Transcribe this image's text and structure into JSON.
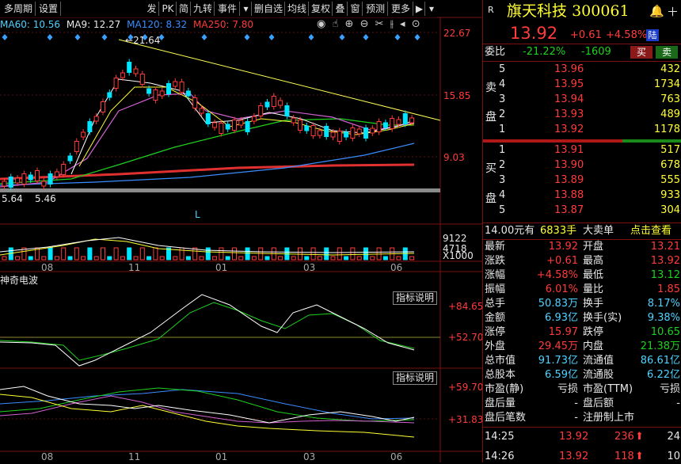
{
  "toolbar": {
    "items": [
      "多周期",
      "设置",
      "发",
      "PK",
      "简",
      "九转",
      "事件",
      "",
      "删自选",
      "均线",
      "复权",
      "叠",
      "窗",
      "预测",
      "更多",
      "",
      ""
    ],
    "icons": [
      "dropdown-icon",
      "arrow-icon",
      "menu-icon"
    ]
  },
  "ma_legend": {
    "ma60": "MA60: 10.56",
    "ma9": "MA9: 12.27",
    "ma120": "MA120: 8.32",
    "ma250": "MA250: 7.80"
  },
  "price_chart": {
    "peak_label": "21.64",
    "low_label_a": "5.64",
    "low_label_b": "5.46",
    "marker_l": "L",
    "axis": [
      "22.67",
      "15.85",
      "9.03"
    ]
  },
  "volume_chart": {
    "axis": [
      "9122",
      "4718",
      "X1000"
    ]
  },
  "date_axis": [
    "08",
    "11",
    "01",
    "03",
    "06"
  ],
  "indicator1": {
    "title": "神奇电波",
    "button": "指标说明",
    "axis": [
      "+84.65",
      "+52.70"
    ]
  },
  "indicator2": {
    "button": "指标说明",
    "axis": [
      "+59.70",
      "+31.83"
    ]
  },
  "quote": {
    "market_badge": "R",
    "name": "旗天科技",
    "code": "300061",
    "price": "13.92",
    "change": "+0.61",
    "change_pct": "+4.58%",
    "exchange_badge": "陆",
    "weibi_label": "委比",
    "weibi": "-21.22%",
    "weicha": "-1609",
    "buy_btn": "买",
    "sell_btn": "卖",
    "sell_label": [
      "卖",
      "盘"
    ],
    "buy_label": [
      "买",
      "盘"
    ],
    "asks": [
      {
        "lvl": "5",
        "price": "13.96",
        "vol": "432"
      },
      {
        "lvl": "4",
        "price": "13.95",
        "vol": "1734"
      },
      {
        "lvl": "3",
        "price": "13.94",
        "vol": "763"
      },
      {
        "lvl": "2",
        "price": "13.93",
        "vol": "489"
      },
      {
        "lvl": "1",
        "price": "13.92",
        "vol": "1178"
      }
    ],
    "bids": [
      {
        "lvl": "1",
        "price": "13.91",
        "vol": "517"
      },
      {
        "lvl": "2",
        "price": "13.90",
        "vol": "678"
      },
      {
        "lvl": "3",
        "price": "13.89",
        "vol": "555"
      },
      {
        "lvl": "4",
        "price": "13.88",
        "vol": "933"
      },
      {
        "lvl": "5",
        "price": "13.87",
        "vol": "304"
      }
    ],
    "bigorder": {
      "a": "14.00元有",
      "b": "6833手",
      "c": "大卖单",
      "d": "点击查看"
    },
    "stats": [
      {
        "l1": "最新",
        "v1": "13.92",
        "l2": "开盘",
        "v2": "13.21"
      },
      {
        "l1": "涨跌",
        "v1": "+0.61",
        "l2": "最高",
        "v2": "13.92"
      },
      {
        "l1": "涨幅",
        "v1": "+4.58%",
        "l2": "最低",
        "v2": "13.12"
      },
      {
        "l1": "振幅",
        "v1": "6.01%",
        "l2": "量比",
        "v2": "1.85"
      },
      {
        "l1": "总手",
        "v1": "50.83万",
        "l2": "换手",
        "v2": "8.17%"
      },
      {
        "l1": "金额",
        "v1": "6.93亿",
        "l2": "换手(实)",
        "v2": "9.38%"
      },
      {
        "l1": "涨停",
        "v1": "15.97",
        "l2": "跌停",
        "v2": "10.65"
      },
      {
        "l1": "外盘",
        "v1": "29.45万",
        "l2": "内盘",
        "v2": "21.38万"
      },
      {
        "l1": "总市值",
        "v1": "91.73亿",
        "l2": "流通值",
        "v2": "86.61亿"
      },
      {
        "l1": "总股本",
        "v1": "6.59亿",
        "l2": "流通股",
        "v2": "6.22亿"
      },
      {
        "l1": "市盈(静)",
        "v1": "亏损",
        "l2": "市盈(TTM)",
        "v2": "亏损"
      },
      {
        "l1": "盘后量",
        "v1": "-",
        "l2": "盘后额",
        "v2": "-"
      },
      {
        "l1": "盘后笔数",
        "v1": "-",
        "l2": "注册制上市",
        "v2": ""
      }
    ],
    "ticks": [
      {
        "time": "14:25",
        "price": "13.92",
        "vol": "236",
        "n": "24"
      },
      {
        "time": "14:26",
        "price": "13.92",
        "vol": "118",
        "n": "10"
      }
    ]
  },
  "colors": {
    "up": "#ff3b3b",
    "down": "#00e5ff",
    "green": "#1fd11f",
    "yellow": "#ffff33",
    "white": "#e8e8e8"
  }
}
